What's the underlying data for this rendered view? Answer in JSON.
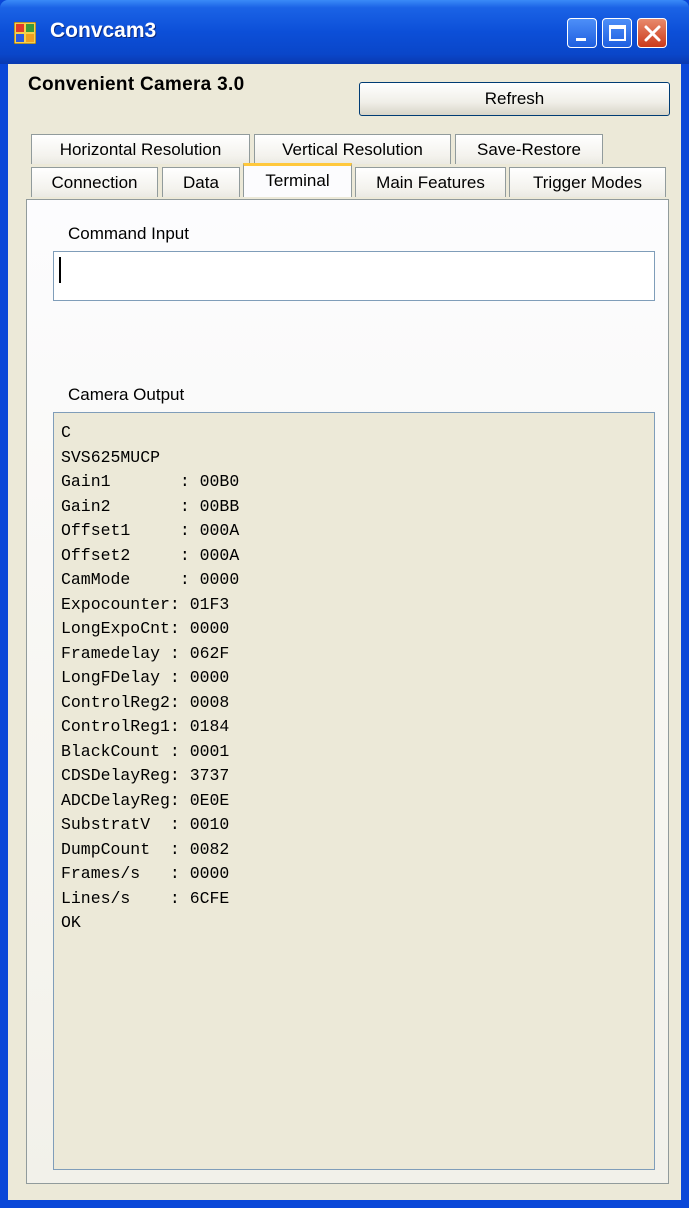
{
  "window": {
    "title": "Convcam3",
    "controls": [
      "minimize",
      "maximize",
      "close"
    ]
  },
  "header": {
    "app_title": "Convenient Camera 3.0",
    "refresh_label": "Refresh"
  },
  "tabs": {
    "row1": [
      "Horizontal Resolution",
      "Vertical Resolution",
      "Save-Restore"
    ],
    "row2": [
      "Connection",
      "Data",
      "Terminal",
      "Main Features",
      "Trigger Modes"
    ],
    "active": "Terminal"
  },
  "terminal": {
    "command_label": "Command Input",
    "command_value": "",
    "output_label": "Camera Output",
    "output_lines": [
      "C",
      "SVS625MUCP",
      "Gain1       : 00B0",
      "Gain2       : 00BB",
      "Offset1     : 000A",
      "Offset2     : 000A",
      "CamMode     : 0000",
      "Expocounter: 01F3",
      "LongExpoCnt: 0000",
      "Framedelay : 062F",
      "LongFDelay : 0000",
      "ControlReg2: 0008",
      "ControlReg1: 0184",
      "BlackCount : 0001",
      "CDSDelayReg: 3737",
      "ADCDelayReg: 0E0E",
      "SubstratV  : 0010",
      "DumpCount  : 0082",
      "Frames/s   : 0000",
      "Lines/s    : 6CFE",
      "OK"
    ]
  },
  "colors": {
    "titlebar": "#0c4fd8",
    "client": "#ece9d8",
    "active_tab_accent": "#ffc83c"
  }
}
